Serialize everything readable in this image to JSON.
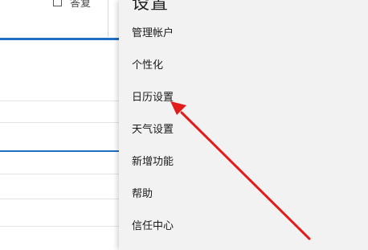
{
  "toolbar": {
    "reply_label": "答复"
  },
  "settings": {
    "title": "设置",
    "items": [
      {
        "label": "管理帐户"
      },
      {
        "label": "个性化"
      },
      {
        "label": "日历设置"
      },
      {
        "label": "天气设置"
      },
      {
        "label": "新增功能"
      },
      {
        "label": "帮助"
      },
      {
        "label": "信任中心"
      }
    ]
  },
  "colors": {
    "accent": "#1f6fc2",
    "panel_bg": "#f2f2f2",
    "annotation_arrow": "#e21b1b"
  },
  "annotation": {
    "points_to": "日历设置"
  }
}
